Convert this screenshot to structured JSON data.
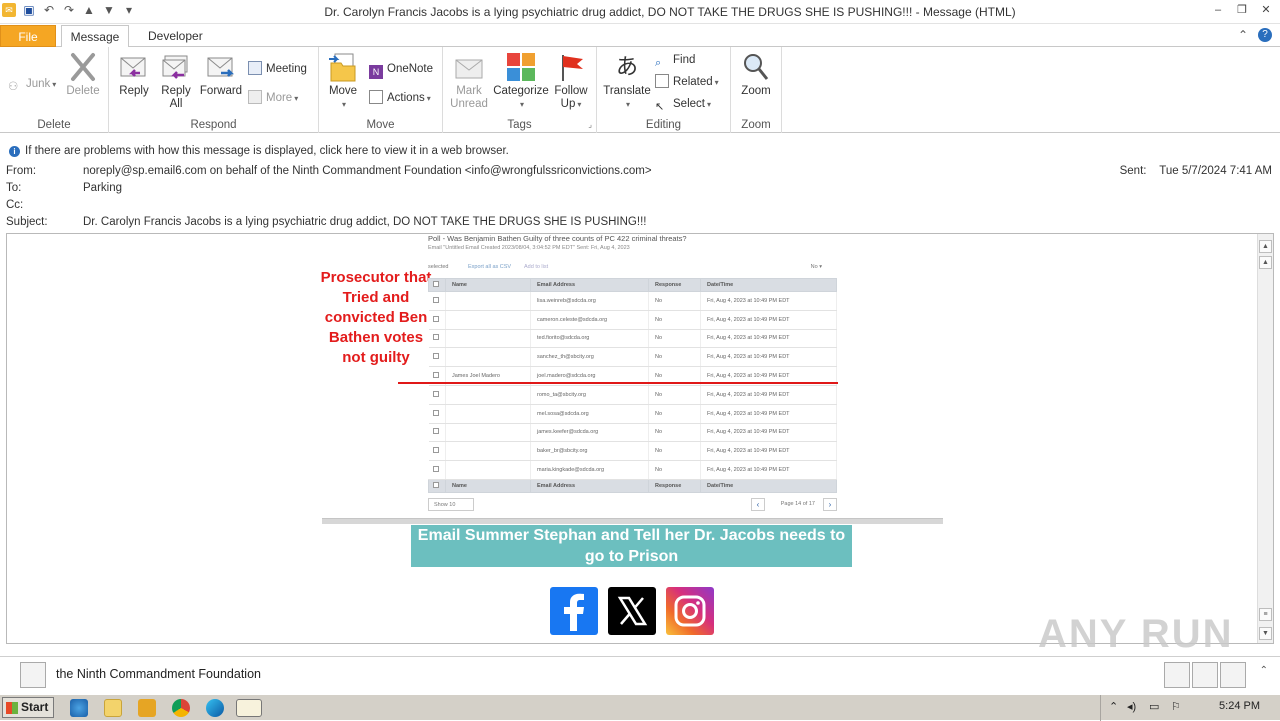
{
  "window": {
    "title": "Dr. Carolyn Francis Jacobs is a lying psychiatric drug addict, DO NOT TAKE THE DRUGS SHE IS PUSHING!!! - Message (HTML)"
  },
  "tabs": [
    {
      "label": "File"
    },
    {
      "label": "Message"
    },
    {
      "label": "Developer"
    }
  ],
  "ribbon": {
    "delete_group": {
      "label": "Delete",
      "junk": "Junk",
      "delete": "Delete"
    },
    "respond_group": {
      "label": "Respond",
      "reply": "Reply",
      "reply_all_1": "Reply",
      "reply_all_2": "All",
      "forward": "Forward",
      "meeting": "Meeting",
      "more": "More"
    },
    "move_group": {
      "label": "Move",
      "move": "Move",
      "onenote": "OneNote",
      "actions": "Actions"
    },
    "tags_group": {
      "label": "Tags",
      "mark_unread_1": "Mark",
      "mark_unread_2": "Unread",
      "categorize": "Categorize",
      "follow_up_1": "Follow",
      "follow_up_2": "Up"
    },
    "editing_group": {
      "label": "Editing",
      "translate": "Translate",
      "find": "Find",
      "related": "Related",
      "select": "Select"
    },
    "zoom_group": {
      "label": "Zoom",
      "zoom": "Zoom"
    }
  },
  "infobar": {
    "text": "If there are problems with how this message is displayed, click here to view it in a web browser."
  },
  "header": {
    "from_label": "From:",
    "from": "noreply@sp.email6.com on behalf of the Ninth Commandment Foundation <info@wrongfulssriconvictions.com>",
    "to_label": "To:",
    "to": "Parking",
    "cc_label": "Cc:",
    "cc": "",
    "subject_label": "Subject:",
    "subject": "Dr. Carolyn Francis Jacobs is a lying psychiatric drug addict, DO NOT TAKE THE DRUGS SHE IS PUSHING!!!",
    "sent_label": "Sent:",
    "sent": "Tue 5/7/2024 7:41 AM"
  },
  "body": {
    "red_note": "Prosecutor that Tried and convicted Ben Bathen votes not guilty",
    "poll_title": "Poll - Was Benjamin Bathen Guilty of three counts of PC 422 criminal threats?",
    "poll_sub": "Email \"Untitled Email Created 2023/08/04, 3:04:52 PM EDT\" Sent: Fri, Aug 4, 2023",
    "toolbar": {
      "selected": "selected",
      "export": "Export all as CSV",
      "add": "Add to list",
      "no": "No ▾"
    },
    "columns": [
      "Name",
      "Email Address",
      "Response",
      "Date/Time"
    ],
    "rows": [
      {
        "name": "",
        "email": "lisa.weinreb@sdcda.org",
        "response": "No",
        "date": "Fri, Aug 4, 2023 at 10:49 PM EDT"
      },
      {
        "name": "",
        "email": "cameron.celeste@sdcda.org",
        "response": "No",
        "date": "Fri, Aug 4, 2023 at 10:49 PM EDT"
      },
      {
        "name": "",
        "email": "ted.fiorito@sdcda.org",
        "response": "No",
        "date": "Fri, Aug 4, 2023 at 10:49 PM EDT"
      },
      {
        "name": "",
        "email": "sanchez_th@sbcity.org",
        "response": "No",
        "date": "Fri, Aug 4, 2023 at 10:49 PM EDT"
      },
      {
        "name": "James Joel Madero",
        "email": "joel.madero@sdcda.org",
        "response": "No",
        "date": "Fri, Aug 4, 2023 at 10:49 PM EDT"
      },
      {
        "name": "",
        "email": "romo_ta@sbcity.org",
        "response": "No",
        "date": "Fri, Aug 4, 2023 at 10:49 PM EDT"
      },
      {
        "name": "",
        "email": "mel.sosa@sdcda.org",
        "response": "No",
        "date": "Fri, Aug 4, 2023 at 10:49 PM EDT"
      },
      {
        "name": "",
        "email": "james.keefer@sdcda.org",
        "response": "No",
        "date": "Fri, Aug 4, 2023 at 10:49 PM EDT"
      },
      {
        "name": "",
        "email": "baker_br@sbcity.org",
        "response": "No",
        "date": "Fri, Aug 4, 2023 at 10:49 PM EDT"
      },
      {
        "name": "",
        "email": "maria.kingkade@sdcda.org",
        "response": "No",
        "date": "Fri, Aug 4, 2023 at 10:49 PM EDT"
      }
    ],
    "pager": {
      "show": "Show 10",
      "page": "Page 14 of 17"
    },
    "cta": "Email Summer Stephan and Tell her Dr. Jacobs needs to go to Prison"
  },
  "people_pane": {
    "name": "the Ninth Commandment Foundation"
  },
  "taskbar": {
    "start": "Start",
    "clock": "5:24 PM"
  },
  "watermark": "ANY RUN",
  "colors": {
    "file_tab": "#f5a623",
    "cta_bg": "#6cbfbf",
    "note_red": "#e31c1c",
    "facebook": "#1877f2"
  }
}
